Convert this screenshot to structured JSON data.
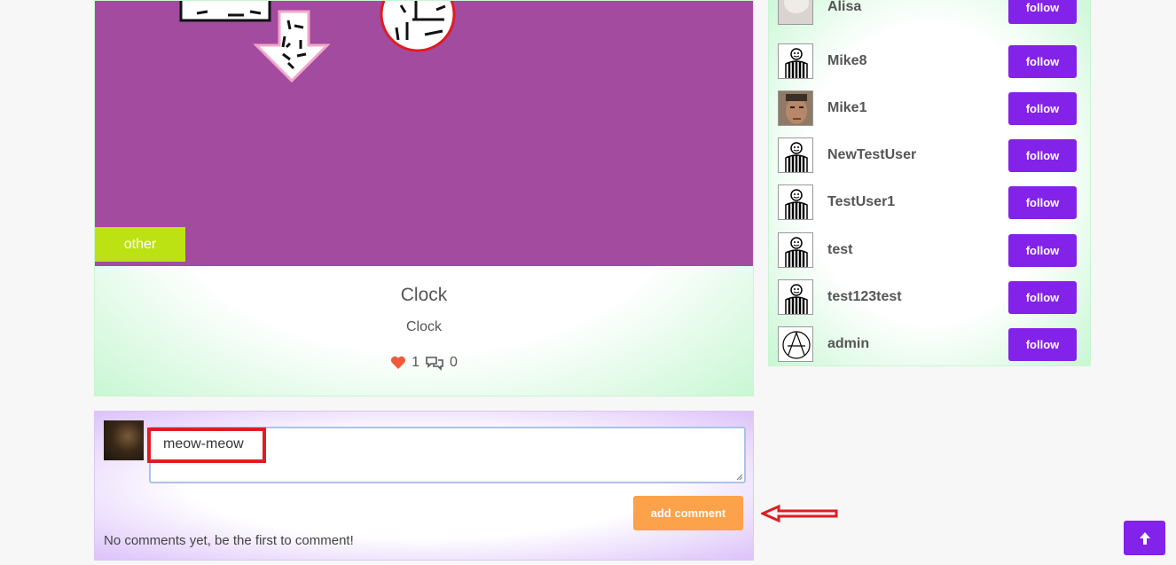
{
  "post": {
    "category": "other",
    "title": "Clock",
    "description": "Clock",
    "likes": "1",
    "comments": "0"
  },
  "comment_form": {
    "input_value": "meow-meow",
    "add_button": "add comment",
    "empty_text": "No comments yet, be the first to comment!"
  },
  "users": [
    {
      "name": "Alisa",
      "avatar": "photo-avatar-light"
    },
    {
      "name": "Mike8",
      "avatar": "striped-figure-avatar"
    },
    {
      "name": "Mike1",
      "avatar": "photo-avatar-face"
    },
    {
      "name": "NewTestUser",
      "avatar": "striped-figure-avatar"
    },
    {
      "name": "TestUser1",
      "avatar": "striped-figure-avatar"
    },
    {
      "name": "test",
      "avatar": "striped-figure-avatar"
    },
    {
      "name": "test123test",
      "avatar": "striped-figure-avatar"
    },
    {
      "name": "admin",
      "avatar": "anarchy-symbol-avatar"
    }
  ],
  "follow_label": "follow",
  "colors": {
    "accent_purple": "#8322e8",
    "post_image_bg": "#a24b9f",
    "category_badge": "#bde213",
    "add_comment_orange": "#fba24a",
    "annotation_red": "#e01c22"
  }
}
